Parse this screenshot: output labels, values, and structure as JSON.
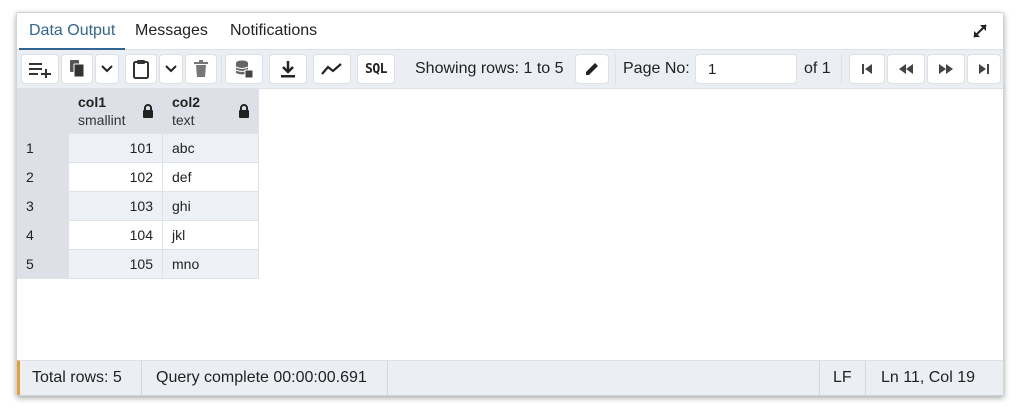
{
  "tabs": [
    {
      "label": "Data Output",
      "active": true
    },
    {
      "label": "Messages",
      "active": false
    },
    {
      "label": "Notifications",
      "active": false
    }
  ],
  "toolbar": {
    "icons": [
      "add-row-icon",
      "copy-icon",
      "chevron-down-icon",
      "paste-icon",
      "chevron-down-icon",
      "delete-icon",
      "save-data-icon",
      "download-icon",
      "graph-icon",
      "sql-icon",
      "edit-icon",
      "first-page-icon",
      "previous-page-icon",
      "next-page-icon",
      "last-page-icon"
    ],
    "sql_label": "SQL",
    "showing_rows": "Showing rows: 1 to 5",
    "page_no_label": "Page No:",
    "page_value": "1",
    "of_label": "of 1"
  },
  "grid": {
    "columns": [
      {
        "name": "col1",
        "type": "smallint"
      },
      {
        "name": "col2",
        "type": "text"
      }
    ],
    "rows": [
      {
        "n": "1",
        "col1": "101",
        "col2": "abc"
      },
      {
        "n": "2",
        "col1": "102",
        "col2": "def"
      },
      {
        "n": "3",
        "col1": "103",
        "col2": "ghi"
      },
      {
        "n": "4",
        "col1": "104",
        "col2": "jkl"
      },
      {
        "n": "5",
        "col1": "105",
        "col2": "mno"
      }
    ]
  },
  "status": {
    "total_rows": "Total rows: 5",
    "query": "Query complete 00:00:00.691",
    "eol": "LF",
    "position": "Ln 11, Col 19"
  },
  "colors": {
    "accent": "#326690",
    "status_marker": "#e59f33"
  }
}
